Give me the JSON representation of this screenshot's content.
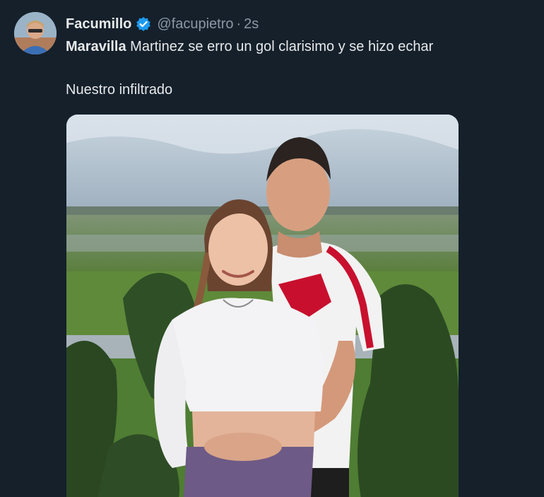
{
  "tweet": {
    "author": {
      "display_name": "Facumillo",
      "handle": "@facupietro",
      "verified_icon": "verified-badge-icon",
      "avatar": "avatar"
    },
    "separator": "·",
    "timestamp": "2s",
    "text_line1_bold": "Maravilla",
    "text_line1_rest": " Martinez se erro un gol clarisimo y se hizo echar",
    "text_line2": "Nuestro infiltrado",
    "media": "photo"
  },
  "colors": {
    "background": "#15202b",
    "text_primary": "#e7e9ea",
    "text_secondary": "#8b98a5",
    "verified_blue": "#1d9bf0"
  }
}
